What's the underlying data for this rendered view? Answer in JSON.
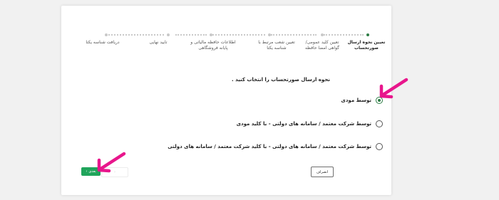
{
  "stepper": {
    "steps": [
      {
        "label": "تعیین نحوه ارسال صورتحساب",
        "active": true
      },
      {
        "label": "تعیین کلید عمومی/گواهی امضا حافظه",
        "active": false
      },
      {
        "label": "تعیین شعب مرتبط با شناسه یکتا",
        "active": false
      },
      {
        "label": "اطلاعات حافظه مالیاتی و پایانه فروشگاهی",
        "active": false
      },
      {
        "label": "تایید نهایی",
        "active": false
      },
      {
        "label": "دریافت شناسه یکتا",
        "active": false
      }
    ]
  },
  "form": {
    "question": "نحوه ارسال صورتحساب را انتخاب کنید .",
    "options": [
      {
        "label": "توسط مودی",
        "checked": true
      },
      {
        "label": "توسط شرکت معتمد / سامانه های دولتی - با کلید مودی",
        "checked": false
      },
      {
        "label": "توسط شرکت معتمد / سامانه های دولتی - با کلید شرکت معتمد / سامانه های دولتی",
        "checked": false
      }
    ]
  },
  "buttons": {
    "cancel_label": "انصراف",
    "next_label": "بعدی",
    "next_icon": "‹",
    "prev_icon": "›"
  },
  "colors": {
    "accent": "#20a45b",
    "annotation_arrow": "#e8168c"
  }
}
